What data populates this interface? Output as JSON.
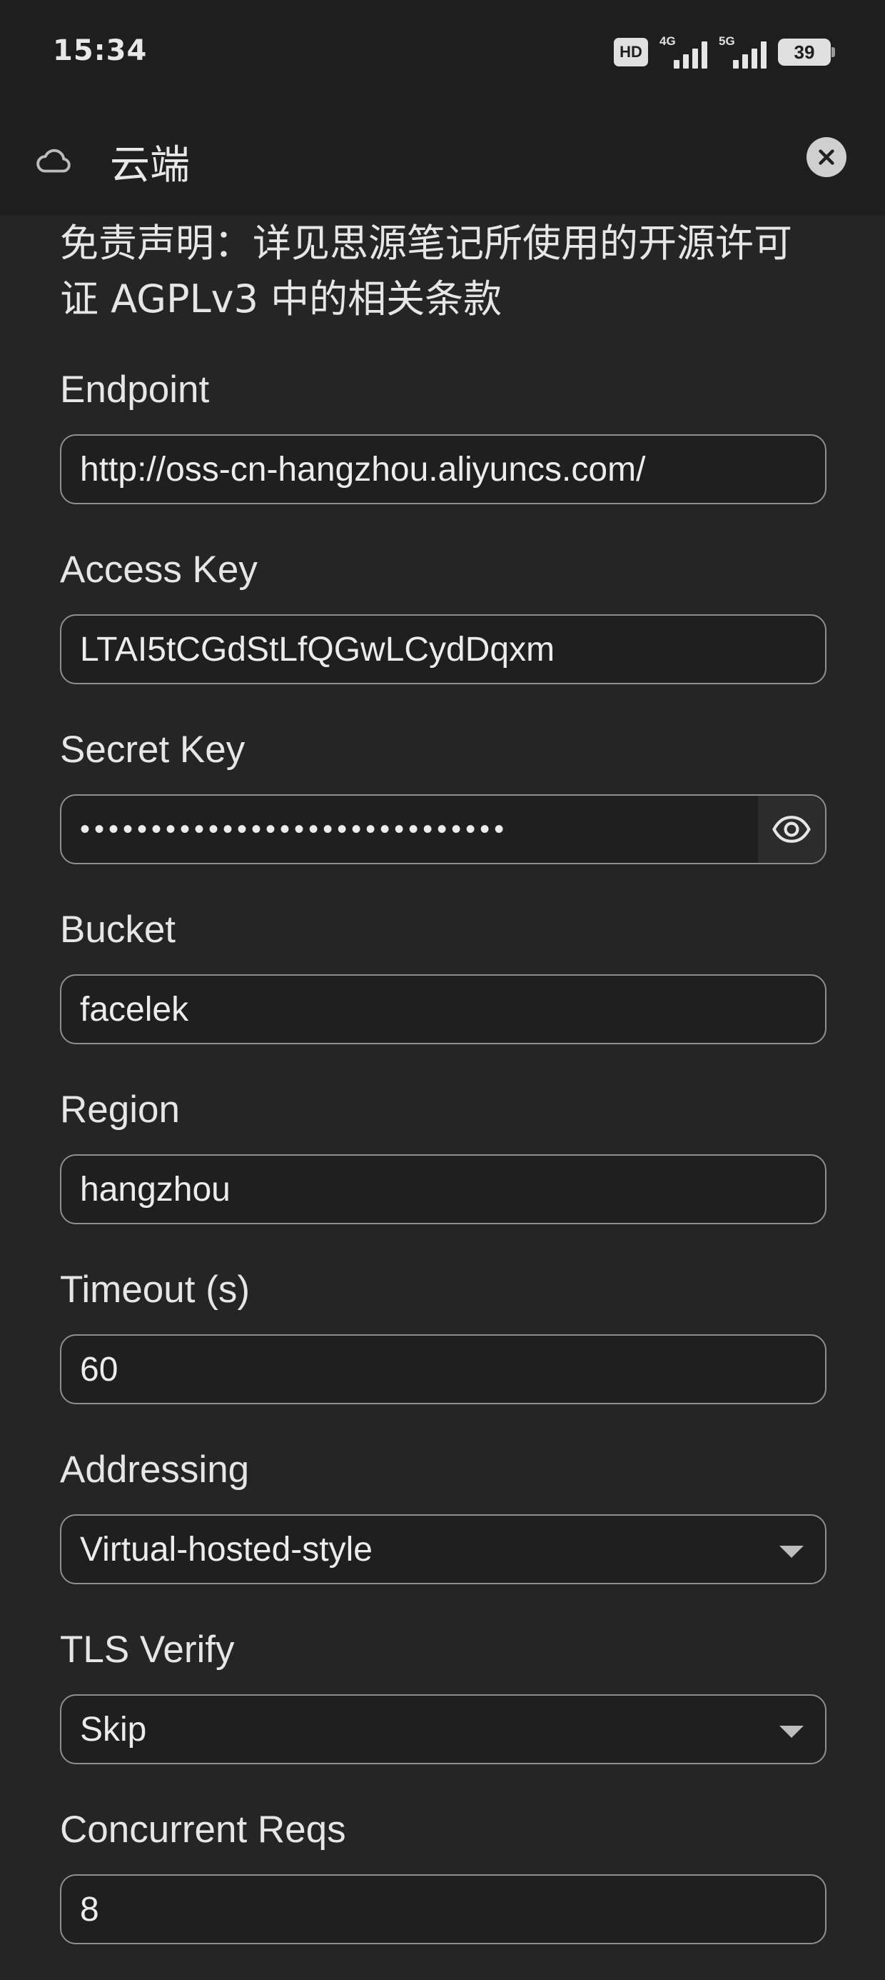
{
  "status_bar": {
    "time": "15:34",
    "hd_label": "HD",
    "network_1": "4G",
    "network_2": "5G",
    "battery": "39"
  },
  "header": {
    "icon": "cloud-icon",
    "title": "云端",
    "close_icon": "close-icon"
  },
  "disclaimer": "免责声明：详见思源笔记所使用的开源许可证 AGPLv3 中的相关条款",
  "fields": {
    "endpoint": {
      "label": "Endpoint",
      "value": "http://oss-cn-hangzhou.aliyuncs.com/"
    },
    "access_key": {
      "label": "Access Key",
      "value": "LTAI5tCGdStLfQGwLCydDqxm"
    },
    "secret_key": {
      "label": "Secret Key",
      "value": "••••••••••••••••••••••••••••••",
      "toggle_icon": "eye-icon"
    },
    "bucket": {
      "label": "Bucket",
      "value": "facelek"
    },
    "region": {
      "label": "Region",
      "value": "hangzhou"
    },
    "timeout": {
      "label": "Timeout (s)",
      "value": "60"
    },
    "addressing": {
      "label": "Addressing",
      "value": "Virtual-hosted-style"
    },
    "tls_verify": {
      "label": "TLS Verify",
      "value": "Skip"
    },
    "concurrent_reqs": {
      "label": "Concurrent Reqs",
      "value": "8"
    }
  }
}
